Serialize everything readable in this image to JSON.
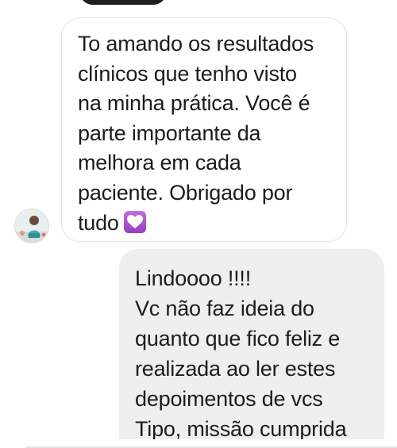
{
  "incoming_message": {
    "lines": [
      "To amando os resultados",
      "clínicos que tenho visto",
      "na minha prática. Você é",
      "parte importante da",
      "melhora em cada",
      "paciente. Obrigado por",
      "tudo"
    ],
    "emoji": "purple-heart-emoji"
  },
  "outgoing_message": {
    "lines": [
      "Lindoooo !!!!",
      "Vc não faz ideia do",
      "quanto que fico feliz e",
      "realizada ao ler estes",
      "depoimentos de vcs",
      "Tipo, missão cumprida"
    ]
  },
  "colors": {
    "incoming_bubble_bg": "#ffffff",
    "incoming_bubble_border": "#e2e2e2",
    "outgoing_bubble_bg": "#efefef",
    "text": "#1c1c1c",
    "emoji_purple": "#a94fcf"
  }
}
